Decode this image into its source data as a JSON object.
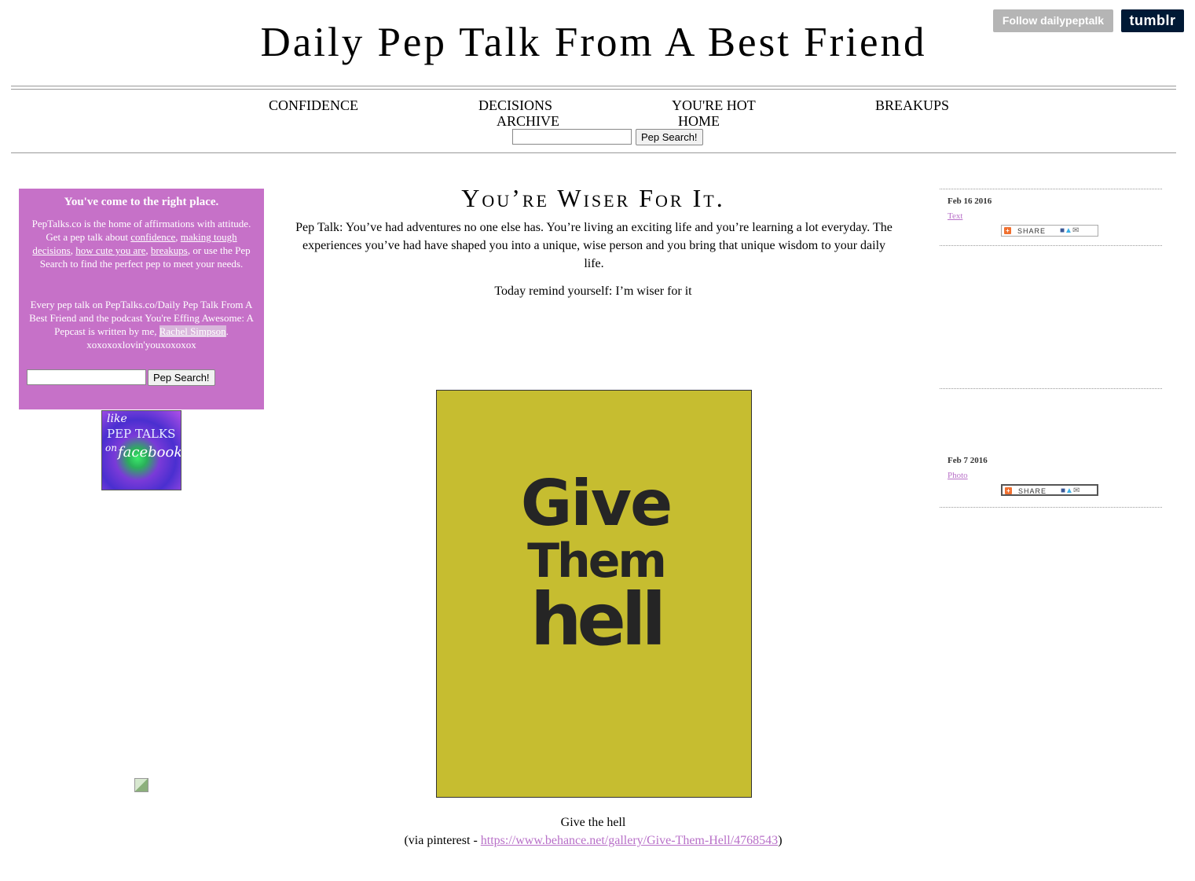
{
  "topbar": {
    "follow_label": "Follow dailypeptalk",
    "tumblr_label": "tumblr"
  },
  "site": {
    "title": "Daily Pep Talk From A Best Friend"
  },
  "nav": {
    "items": [
      "CONFIDENCE",
      "DECISIONS",
      "YOU'RE HOT",
      "BREAKUPS",
      "ARCHIVE",
      "HOME"
    ],
    "search_button": "Pep Search!",
    "search_value": ""
  },
  "sidebar": {
    "heading": "You've come to the right place.",
    "intro_1": "PepTalks.co is the home of affirmations with attitude. Get a pep talk about ",
    "link_confidence": "confidence",
    "sep_1": ", ",
    "link_decisions": "making tough decisions",
    "sep_2": ", ",
    "link_cute": "how cute you are",
    "sep_3": ", ",
    "link_breakups": "breakups",
    "intro_2": ", or use the Pep Search to find the perfect pep to meet your needs.",
    "para2_text": "Every pep talk on PepTalks.co/Daily Pep Talk From A Best Friend and the podcast You're Effing Awesome: A Pepcast is written by me, ",
    "author_link": "Rachel Simpson",
    "para2_end": ". xoxoxoxlovin'youxoxoxox",
    "search_button": "Pep Search!",
    "fb_badge": {
      "line1": "like",
      "line2": "PEP TALKS",
      "line3": "on",
      "line4": "facebook"
    }
  },
  "post": {
    "title": "You’re Wiser For It.",
    "body": "Pep Talk: You’ve had adventures no one else has. You’re living an exciting life and you’re learning a lot everyday. The experiences you’ve had have shaped you into a unique, wise person and you bring that unique wisdom to your daily life.",
    "reminder": "Today remind yourself: I’m wiser for it",
    "poster": {
      "line1": "Give",
      "line2": "Them",
      "line3": "hell",
      "bg_color": "#c6bd30"
    },
    "caption": "Give the hell",
    "via_prefix": "(via pinterest - ",
    "via_link": "https://www.behance.net/gallery/Give-Them-Hell/4768543",
    "via_suffix": ")"
  },
  "right_sidebar": {
    "posts": [
      {
        "date": "Feb 16 2016",
        "type": "Text",
        "share_label": "SHARE"
      },
      {
        "date": "Feb 7 2016",
        "type": "Photo",
        "share_label": "SHARE"
      }
    ]
  },
  "colors": {
    "sidebar_bg": "#c671c8",
    "link": "#b870c8",
    "tumblr_bg": "#001935",
    "follow_bg": "#b5b5b5"
  }
}
